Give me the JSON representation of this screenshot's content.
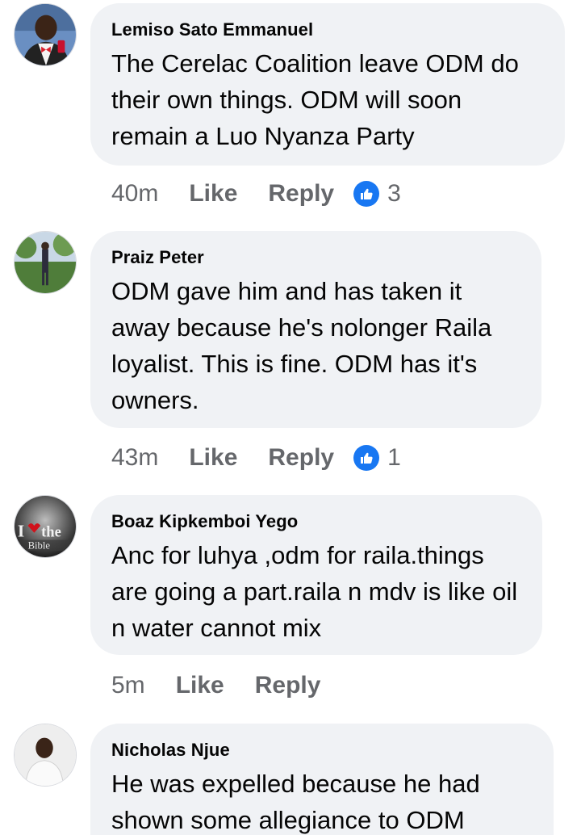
{
  "comments": [
    {
      "author": "Lemiso Sato Emmanuel",
      "text": "The Cerelac Coalition leave ODM do their own things. ODM will soon remain a Luo Nyanza Party",
      "time": "40m",
      "like_label": "Like",
      "reply_label": "Reply",
      "reactions": "3",
      "avatar_icon": "profile-photo-man-red-bowtie"
    },
    {
      "author": "Praiz Peter",
      "text": "ODM gave him and has taken it away because he's nolonger Raila loyalist. This is fine. ODM has it's owners.",
      "time": "43m",
      "like_label": "Like",
      "reply_label": "Reply",
      "reactions": "1",
      "avatar_icon": "profile-photo-man-outdoors"
    },
    {
      "author": "Boaz Kipkemboi Yego",
      "text": "Anc for luhya ,odm for raila.things are going a part.raila n mdv is like oil n water cannot mix",
      "time": "5m",
      "like_label": "Like",
      "reply_label": "Reply",
      "avatar_icon": "profile-photo-i-love-the-bible",
      "avatar_text_top": "I",
      "avatar_text_the": "the",
      "avatar_text_bible": "Bible"
    },
    {
      "author": "Nicholas Njue",
      "text": "He was expelled because he had shown some allegiance to ODM",
      "avatar_icon": "profile-photo-man-white-shirt"
    }
  ],
  "colors": {
    "bubble": "#f0f2f5",
    "meta_text": "#65676b",
    "like_blue": "#1877f2"
  }
}
